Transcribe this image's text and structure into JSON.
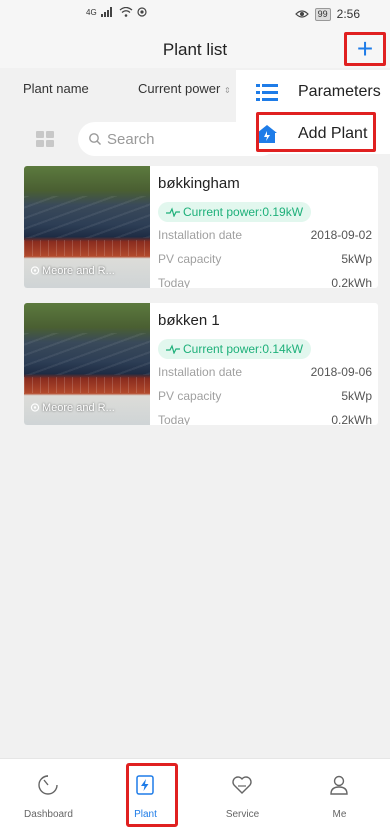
{
  "status": {
    "signal": "4G",
    "battery": "99",
    "time": "2:56"
  },
  "header": {
    "title": "Plant list"
  },
  "sort": {
    "name_label": "Plant name",
    "power_label": "Current power"
  },
  "search": {
    "placeholder": "Search"
  },
  "menu": {
    "parameters": "Parameters",
    "add_plant": "Add Plant"
  },
  "plants": [
    {
      "name": "bøkkingham",
      "power": "Current power:0.19kW",
      "location": "Meore and R...",
      "install_label": "Installation date",
      "install_date": "2018-09-02",
      "capacity_label": "PV capacity",
      "capacity": "5kWp",
      "today_label": "Today",
      "today": "0.2kWh"
    },
    {
      "name": "bøkken 1",
      "power": "Current power:0.14kW",
      "location": "Meore and R...",
      "install_label": "Installation date",
      "install_date": "2018-09-06",
      "capacity_label": "PV capacity",
      "capacity": "5kWp",
      "today_label": "Today",
      "today": "0.2kWh"
    }
  ],
  "tabs": [
    {
      "label": "Dashboard",
      "icon": "dashboard-icon"
    },
    {
      "label": "Plant",
      "icon": "plant-icon"
    },
    {
      "label": "Service",
      "icon": "service-icon"
    },
    {
      "label": "Me",
      "icon": "user-icon"
    }
  ],
  "colors": {
    "accent": "#1e7ce8",
    "highlight": "#e02020",
    "power_green": "#1eb07a"
  }
}
